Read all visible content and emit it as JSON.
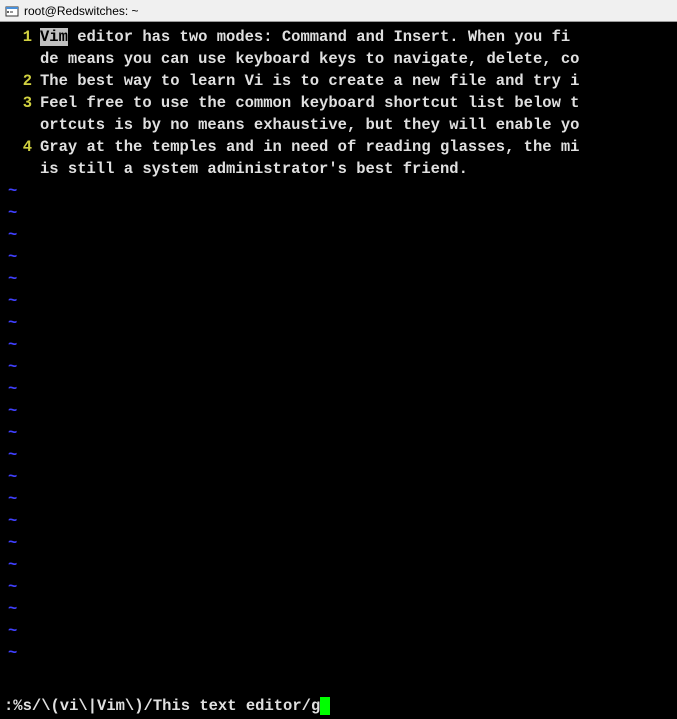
{
  "titleBar": {
    "text": "root@Redswitches: ~"
  },
  "lines": [
    {
      "num": "1",
      "highlighted": "Vim",
      "rest": " editor has two modes: Command and Insert. When you fi",
      "wrap": "de means you can use keyboard keys to navigate, delete, co"
    },
    {
      "num": "2",
      "highlighted": "",
      "rest": "The best way to learn Vi is to create a new file and try i",
      "wrap": ""
    },
    {
      "num": "3",
      "highlighted": "",
      "rest": "Feel free to use the common keyboard shortcut list below t",
      "wrap": "ortcuts is by no means exhaustive, but they will enable yo"
    },
    {
      "num": "4",
      "highlighted": "",
      "rest": "Gray at the temples and in need of reading glasses, the mi",
      "wrap": "is still a system administrator's best friend."
    }
  ],
  "tilde": "~",
  "commandLine": ":%s/\\(vi\\|Vim\\)/This text editor/g"
}
